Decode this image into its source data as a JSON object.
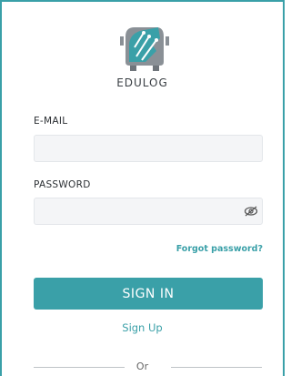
{
  "brand": {
    "name": "EDULOG"
  },
  "form": {
    "email_label": "E-MAIL",
    "email_value": "",
    "email_placeholder": "",
    "password_label": "PASSWORD",
    "password_value": "",
    "password_placeholder": "",
    "forgot_label": "Forgot password?",
    "signin_label": "SIGN IN",
    "signup_label": "Sign Up",
    "divider_label": "Or"
  },
  "colors": {
    "accent": "#3aa0a8",
    "input_bg": "#f4f5f7",
    "border": "#3aa0a8"
  },
  "icons": {
    "logo": "edulog-bus-logo",
    "password_toggle": "eye-icon"
  }
}
